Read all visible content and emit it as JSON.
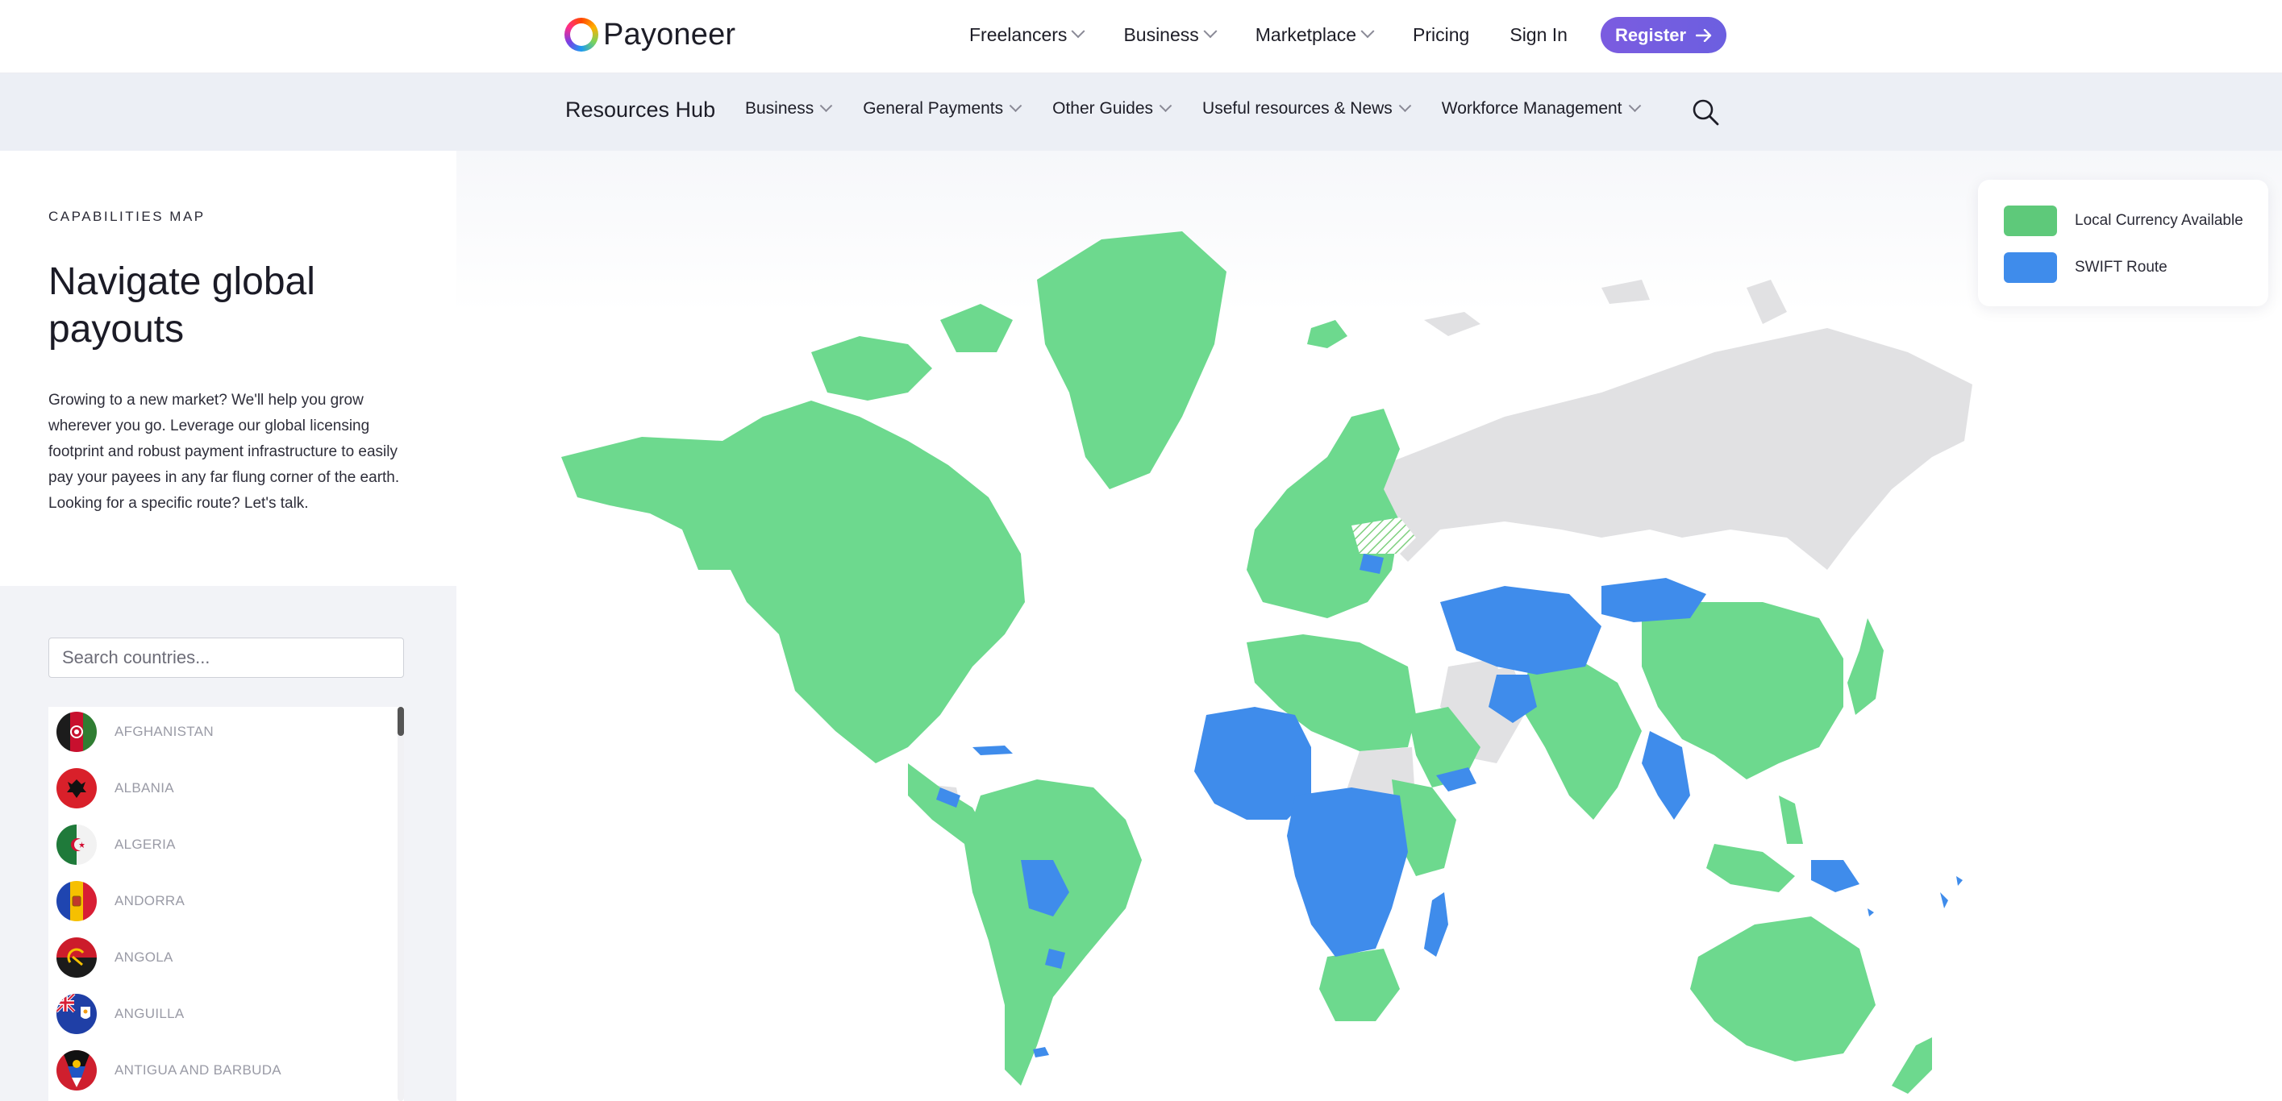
{
  "brand": {
    "name": "Payoneer"
  },
  "top_nav": {
    "items": [
      {
        "label": "Freelancers",
        "dropdown": true
      },
      {
        "label": "Business",
        "dropdown": true
      },
      {
        "label": "Marketplace",
        "dropdown": true
      },
      {
        "label": "Pricing",
        "dropdown": false
      },
      {
        "label": "Sign In",
        "dropdown": false
      }
    ],
    "register_label": "Register"
  },
  "sub_nav": {
    "title": "Resources Hub",
    "items": [
      {
        "label": "Business"
      },
      {
        "label": "General Payments"
      },
      {
        "label": "Other Guides"
      },
      {
        "label": "Useful resources & News"
      },
      {
        "label": "Workforce Management"
      }
    ]
  },
  "intro": {
    "eyebrow": "CAPABILITIES MAP",
    "title": "Navigate global payouts",
    "description": "Growing to a new market? We'll help you grow wherever you go. Leverage our global licensing footprint and robust payment infrastructure to easily pay your payees in any far flung corner of the earth. Looking for a specific route? Let's talk."
  },
  "search": {
    "placeholder": "Search countries..."
  },
  "countries": [
    {
      "name": "AFGHANISTAN",
      "icon": "afghanistan-flag-icon"
    },
    {
      "name": "ALBANIA",
      "icon": "albania-flag-icon"
    },
    {
      "name": "ALGERIA",
      "icon": "algeria-flag-icon"
    },
    {
      "name": "ANDORRA",
      "icon": "andorra-flag-icon"
    },
    {
      "name": "ANGOLA",
      "icon": "angola-flag-icon"
    },
    {
      "name": "ANGUILLA",
      "icon": "anguilla-flag-icon"
    },
    {
      "name": "ANTIGUA AND BARBUDA",
      "icon": "antigua-and-barbuda-flag-icon"
    }
  ],
  "legend": {
    "items": [
      {
        "label": "Local Currency Available",
        "color": "#5ec97a"
      },
      {
        "label": "SWIFT Route",
        "color": "#3f8ceb"
      }
    ]
  },
  "colors": {
    "accent": "#6f5de0",
    "local_currency": "#6dd98e",
    "swift": "#3f8ceb",
    "unavailable": "#e1e1e3"
  }
}
